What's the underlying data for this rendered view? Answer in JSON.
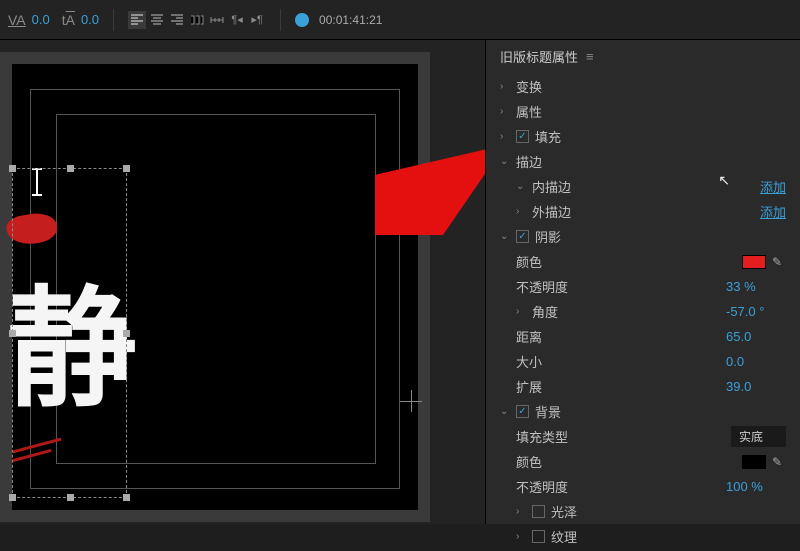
{
  "toolbar": {
    "va_value": "0.0",
    "ta_value": "0.0",
    "timecode": "00:01:41:21"
  },
  "canvas": {
    "character": "静"
  },
  "panel": {
    "title": "旧版标题属性",
    "sections": {
      "transform": "变换",
      "properties": "属性",
      "fill": "填充",
      "stroke": "描边",
      "inner_stroke": "内描边",
      "outer_stroke": "外描边",
      "add_link": "添加",
      "shadow": "阴影",
      "color": "颜色",
      "opacity": "不透明度",
      "opacity_val": "33 %",
      "angle": "角度",
      "angle_val": "-57.0 °",
      "distance": "距离",
      "distance_val": "65.0",
      "size": "大小",
      "size_val": "0.0",
      "spread": "扩展",
      "spread_val": "39.0",
      "background": "背景",
      "fill_type": "填充类型",
      "fill_type_val": "实底",
      "bg_opacity_val": "100 %",
      "sheen": "光泽",
      "texture": "纹理"
    }
  }
}
